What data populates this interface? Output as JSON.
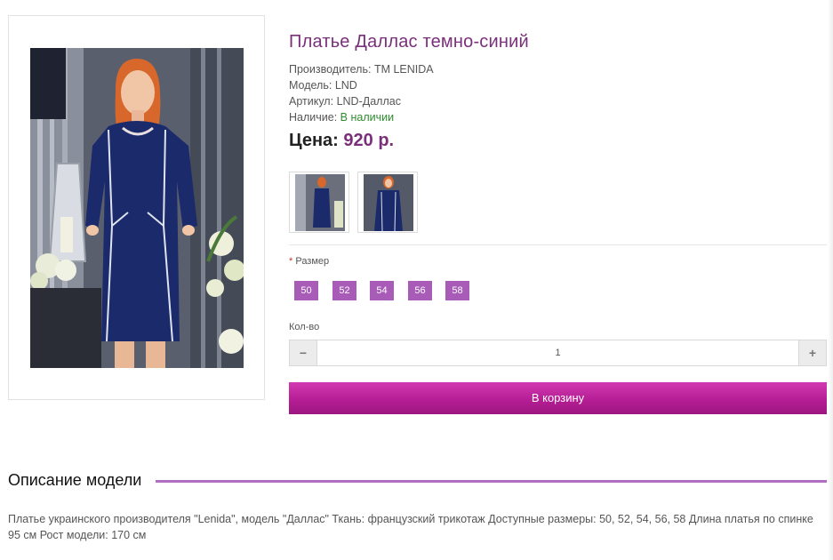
{
  "product": {
    "title": "Платье Даллас темно-синий",
    "manufacturer_label": "Производитель:",
    "manufacturer": "ТМ LENIDA",
    "model_label": "Модель:",
    "model": "LND",
    "article_label": "Артикул:",
    "article": "LND-Даллас",
    "availability_label": "Наличие:",
    "availability": "В наличии",
    "price_label": "Цена:",
    "price": "920 р.",
    "availability_color": "#2e8b2e",
    "accent_color": "#7a2f7a"
  },
  "options": {
    "size_required_mark": "*",
    "size_label": "Размер",
    "sizes": [
      "50",
      "52",
      "54",
      "56",
      "58"
    ],
    "size_color": "#a85cb8"
  },
  "quantity": {
    "label": "Кол-во",
    "minus": "−",
    "plus": "+",
    "value": "1"
  },
  "cart": {
    "button_label": "В корзину",
    "button_color": "#b61e95"
  },
  "description": {
    "title": "Описание модели",
    "text": "Платье украинского производителя \"Lenida\", модель \"Даллас\" Ткань: французский трикотаж Доступные размеры: 50, 52, 54, 56, 58 Длина платья по спинке 95 см Рост модели: 170 см"
  }
}
